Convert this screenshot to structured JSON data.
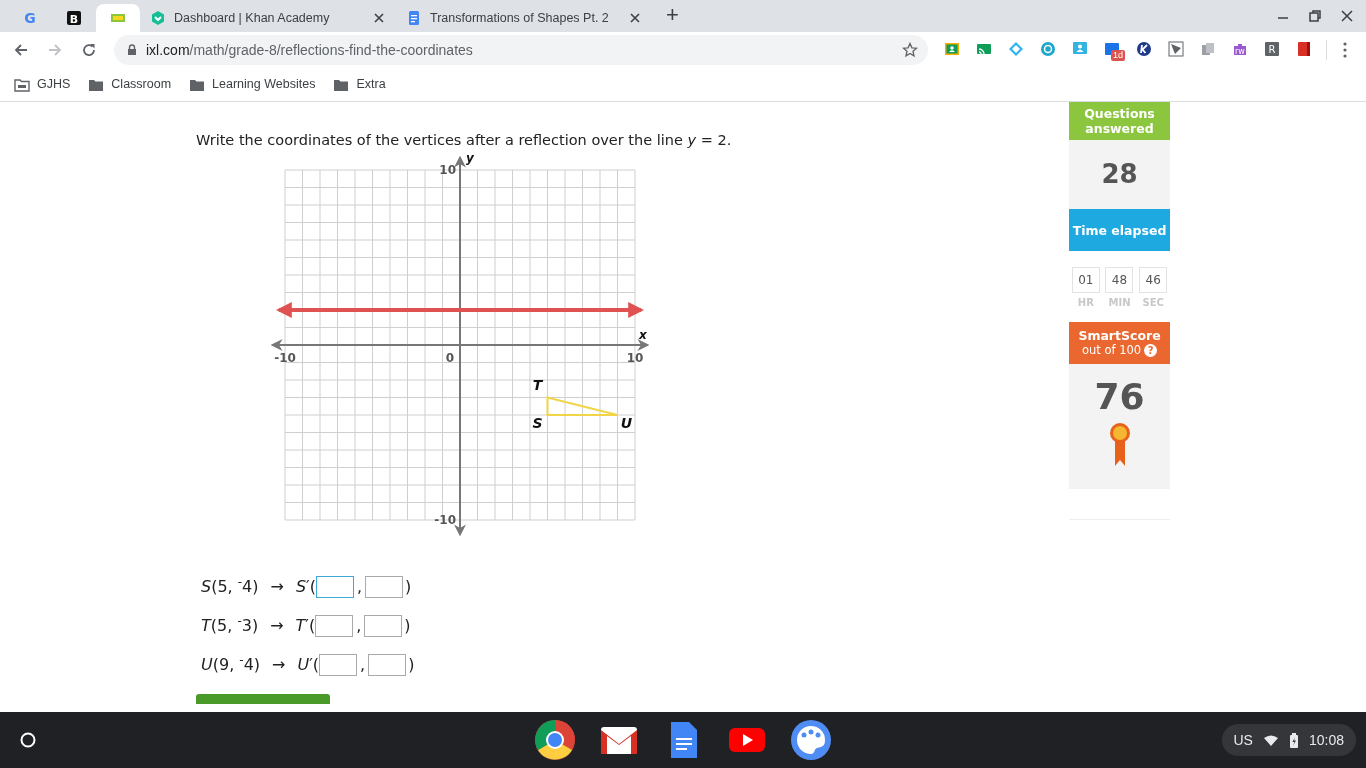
{
  "browser": {
    "tabs": [
      {
        "selected": false
      },
      {
        "selected": false
      },
      {
        "selected": true
      },
      {
        "title": "Dashboard | Khan Academy",
        "selected": false
      },
      {
        "title": "Transformations of Shapes Pt. 2",
        "selected": false
      }
    ],
    "new_tab": "+",
    "address": {
      "host": "ixl.com",
      "path": "/math/grade-8/reflections-find-the-coordinates"
    },
    "extension_badge": "1d",
    "extension_puzzle_label": "rw",
    "extension_letter": "R",
    "tab_logos": [
      "G",
      "B"
    ],
    "bookmarks": [
      {
        "kind": "shared",
        "label": "GJHS"
      },
      {
        "kind": "folder",
        "label": "Classroom"
      },
      {
        "kind": "folder",
        "label": "Learning Websites"
      },
      {
        "kind": "folder",
        "label": "Extra"
      }
    ]
  },
  "question": {
    "prompt": "Write the coordinates of the vertices after a reflection over the line *y* = 2.",
    "graph": {
      "x_axis_label": "x",
      "y_axis_label": "y",
      "x_ticks": [
        "-10",
        "0",
        "10"
      ],
      "y_ticks": [
        "10",
        "-10"
      ],
      "vertices": [
        "T",
        "S",
        "U"
      ]
    },
    "answers": [
      {
        "point": "*S*(5, $^{-}$4)",
        "arrow": "→",
        "image": "*S*′(",
        "comma": ",",
        "close": ")",
        "focused": true
      },
      {
        "point": "*T*(5, $^{-}$3)",
        "arrow": "→",
        "image": "*T*′(",
        "comma": ",",
        "close": ")",
        "focused": false
      },
      {
        "point": "*U*(9, $^{-}$4)",
        "arrow": "→",
        "image": "*U*′(",
        "comma": ",",
        "close": ")",
        "focused": false
      }
    ]
  },
  "sidebar": {
    "questions": {
      "label": "Questions answered",
      "value": "28"
    },
    "time": {
      "label": "Time elapsed",
      "units": [
        {
          "value": "01",
          "unit": "HR"
        },
        {
          "value": "48",
          "unit": "MIN"
        },
        {
          "value": "46",
          "unit": "SEC"
        }
      ]
    },
    "smartscore": {
      "label": "SmartScore",
      "sublabel": "out of 100",
      "help": "?",
      "value": "76"
    }
  },
  "taskbar": {
    "locale": "US",
    "time": "10:08"
  }
}
